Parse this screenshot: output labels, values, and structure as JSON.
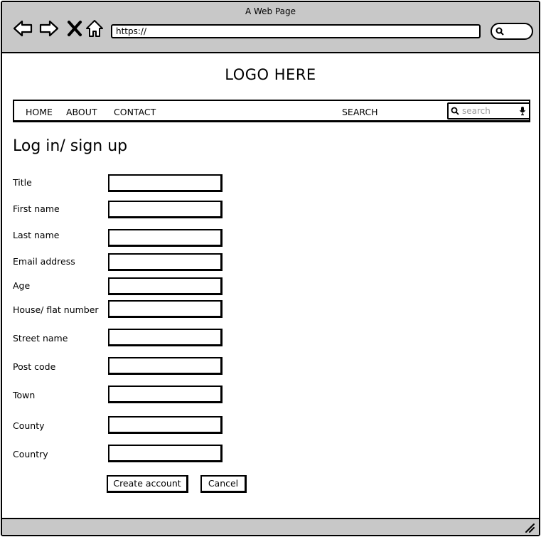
{
  "browser": {
    "title": "A Web Page",
    "url": "https://",
    "icons": [
      "back-arrow-icon",
      "forward-arrow-icon",
      "close-x-icon",
      "home-icon",
      "search-icon"
    ]
  },
  "site": {
    "logo": "LOGO HERE"
  },
  "nav": {
    "home": "HOME",
    "about": "ABOUT",
    "contact": "CONTACT",
    "search_label": "SEARCH",
    "search_placeholder": "search"
  },
  "form": {
    "heading": "Log in/ sign up",
    "fields": [
      {
        "label": "Title",
        "value": ""
      },
      {
        "label": "First name",
        "value": ""
      },
      {
        "label": "Last name",
        "value": ""
      },
      {
        "label": "Email address",
        "value": ""
      },
      {
        "label": "Age",
        "value": ""
      },
      {
        "label": "House/ flat number",
        "value": ""
      },
      {
        "label": "Street name",
        "value": ""
      },
      {
        "label": "Post code",
        "value": ""
      },
      {
        "label": "Town",
        "value": ""
      },
      {
        "label": "County",
        "value": ""
      },
      {
        "label": "Country",
        "value": ""
      }
    ],
    "create_label": "Create account",
    "cancel_label": "Cancel"
  }
}
